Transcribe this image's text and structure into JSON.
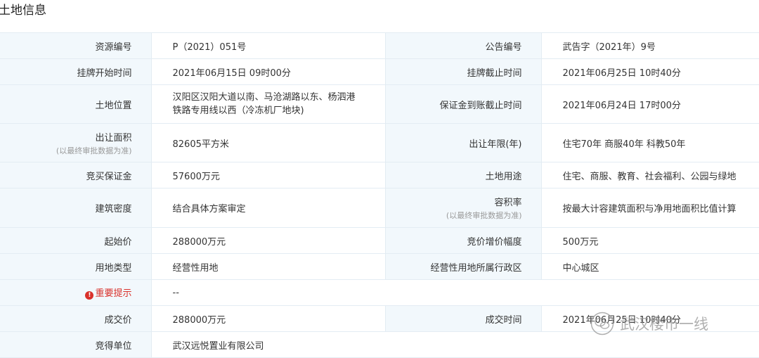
{
  "section_title": "土地信息",
  "rows": [
    {
      "l1": "资源编号",
      "v1": "P（2021）051号",
      "l2": "公告编号",
      "v2": "武告字（2021年）9号"
    },
    {
      "l1": "挂牌开始时间",
      "v1": "2021年06月15日 09时00分",
      "l2": "挂牌截止时间",
      "v2": "2021年06月25日 10时40分"
    },
    {
      "l1": "土地位置",
      "v1_line1": "汉阳区汉阳大道以南、马沧湖路以东、杨泗港",
      "v1_line2": "铁路专用线以西（冷冻机厂地块)",
      "l2": "保证金到账截止时间",
      "v2": "2021年06月24日 17时00分"
    },
    {
      "l1": "出让面积",
      "l1_sub": "(以最终审批数据为准)",
      "v1": "82605平方米",
      "l2": "出让年限(年)",
      "v2": "住宅70年 商服40年 科教50年"
    },
    {
      "l1": "竞买保证金",
      "v1": "57600万元",
      "l2": "土地用途",
      "v2": "住宅、商服、教育、社会福利、公园与绿地"
    },
    {
      "l1": "建筑密度",
      "v1": "结合具体方案审定",
      "l2": "容积率",
      "l2_sub": "(以最终审批数据为准)",
      "v2": "按最大计容建筑面积与净用地面积比值计算"
    },
    {
      "l1": "起始价",
      "v1": "288000万元",
      "l2": "竞价增价幅度",
      "v2": "500万元"
    },
    {
      "l1": "用地类型",
      "v1": "经营性用地",
      "l2": "经营性用地所属行政区",
      "v2": "中心城区"
    },
    {
      "l1": "重要提示",
      "v1": "--"
    },
    {
      "l1": "成交价",
      "v1": "288000万元",
      "l2": "成交时间",
      "v2": "2021年06月25日 10时40分"
    },
    {
      "l1": "竞得单位",
      "v1": "武汉远悦置业有限公司"
    }
  ],
  "watermark": {
    "text": "武汉楼市一线",
    "icon": "wechat-icon"
  },
  "warn_icon_glyph": "!",
  "colors": {
    "label_bg": "#f2f8fc",
    "border": "#e3ecf3",
    "warning": "#d9312b"
  }
}
